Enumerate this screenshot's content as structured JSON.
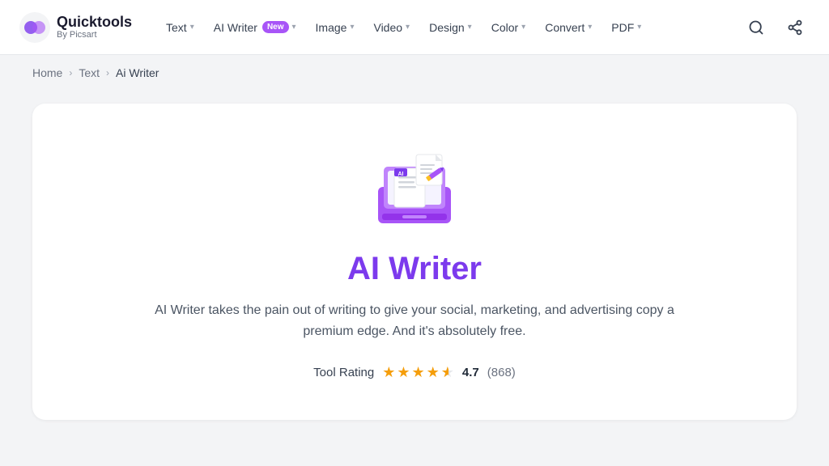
{
  "header": {
    "logo_brand": "Quicktools",
    "logo_sub": "By Picsart",
    "nav_items": [
      {
        "id": "text",
        "label": "Text",
        "has_dropdown": true,
        "badge": null
      },
      {
        "id": "ai-writer",
        "label": "AI Writer",
        "has_dropdown": true,
        "badge": "New"
      },
      {
        "id": "image",
        "label": "Image",
        "has_dropdown": true,
        "badge": null
      },
      {
        "id": "video",
        "label": "Video",
        "has_dropdown": true,
        "badge": null
      },
      {
        "id": "design",
        "label": "Design",
        "has_dropdown": true,
        "badge": null
      },
      {
        "id": "color",
        "label": "Color",
        "has_dropdown": true,
        "badge": null
      },
      {
        "id": "convert",
        "label": "Convert",
        "has_dropdown": true,
        "badge": null
      },
      {
        "id": "pdf",
        "label": "PDF",
        "has_dropdown": true,
        "badge": null
      }
    ]
  },
  "breadcrumb": {
    "items": [
      {
        "label": "Home",
        "active": false
      },
      {
        "label": "Text",
        "active": false
      },
      {
        "label": "Ai Writer",
        "active": true
      }
    ]
  },
  "tool": {
    "title": "AI Writer",
    "description": "AI Writer takes the pain out of writing to give your social, marketing, and advertising copy a premium edge. And it's absolutely free.",
    "rating_label": "Tool Rating",
    "rating_value": "4.7",
    "rating_count": "(868)",
    "stars_full": 4,
    "stars_half": true
  }
}
